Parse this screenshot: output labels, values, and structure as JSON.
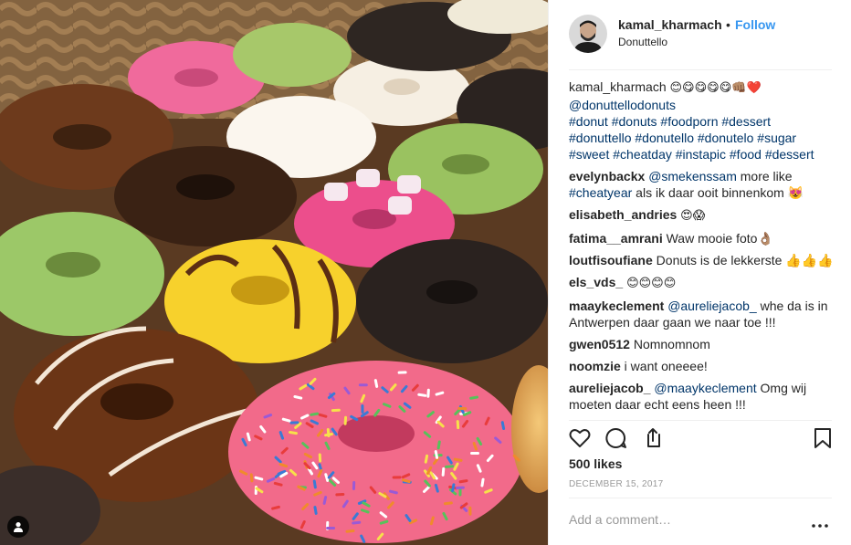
{
  "post": {
    "image_alt": "donuts",
    "username": "kamal_kharmach",
    "follow_label": "Follow",
    "separator": "•",
    "location": "Donuttello"
  },
  "caption": {
    "username": "kamal_kharmach",
    "emoji": "😊😋😋😋😋👊🏽❤️",
    "lines": [
      "@donuttellodonuts",
      "#donut #donuts #foodporn #dessert",
      "#donuttello #donutello #donutelo #sugar",
      "#sweet #cheatday #instapic #food #dessert"
    ]
  },
  "comments": [
    {
      "username": "evelynbackx",
      "mention": "@smekenssam",
      "text": " more like ",
      "tag": "#cheatyear",
      "text2": " als ik daar ooit binnenkom 😻"
    },
    {
      "username": "elisabeth_andries",
      "text": "😍😱"
    },
    {
      "username": "fatima__amrani",
      "text": "Waw mooie foto👌🏽"
    },
    {
      "username": "loutfisoufiane",
      "text": "Donuts is de lekkerste 👍👍👍"
    },
    {
      "username": "els_vds_",
      "text": "😊😊😊😊"
    },
    {
      "username": "maaykeclement",
      "mention": "@aureliejacob_",
      "text": " whe da is in Antwerpen daar gaan we naar toe !!!"
    },
    {
      "username": "gwen0512",
      "text": "Nomnomnom"
    },
    {
      "username": "noomzie",
      "text": "i want oneeee!"
    },
    {
      "username": "aureliejacob_",
      "mention": "@maaykeclement",
      "text": " Omg wij moeten daar echt eens heen !!!"
    }
  ],
  "actions": {
    "like_icon": "heart-icon",
    "comment_icon": "comment-icon",
    "share_icon": "share-icon",
    "save_icon": "bookmark-icon"
  },
  "likes": "500 likes",
  "date": "DECEMBER 15, 2017",
  "add_comment": {
    "placeholder": "Add a comment…"
  },
  "more_label": "•••",
  "colors": {
    "link": "#003569",
    "follow": "#3897f0",
    "muted": "#999999",
    "text": "#262626"
  }
}
